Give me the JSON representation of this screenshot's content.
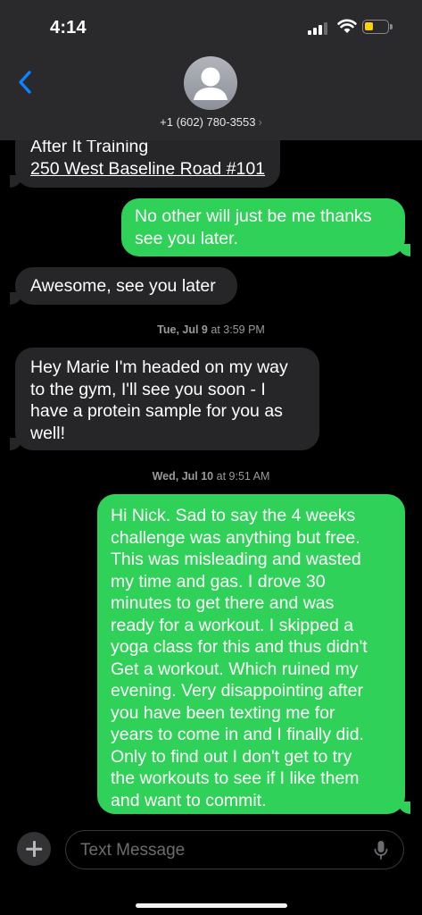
{
  "status_bar": {
    "time": "4:14"
  },
  "header": {
    "phone": "+1 (602) 780-3553",
    "chevron": "›"
  },
  "messages": [
    {
      "lines": [
        "After It Training",
        "250 West Baseline Road #101"
      ]
    },
    {
      "lines": [
        "No other will just be me thanks",
        "see you later."
      ]
    },
    {
      "lines": [
        "Awesome, see you later"
      ]
    },
    {
      "lines": [
        "Hey Marie I'm headed on my way",
        "to the gym, I'll see you soon - I",
        "have a protein sample for you as",
        "well!"
      ]
    },
    {
      "lines": [
        "Hi Nick. Sad to say the 4 weeks",
        "challenge was anything but free.",
        "This was misleading and wasted",
        "my time and gas. I drove 30",
        "minutes to get there and was",
        "ready for a workout. I skipped a",
        "yoga class for this and thus didn't",
        "Get a workout.  Which ruined my",
        "evening. Very disappointing after",
        "you have been texting me for",
        "years to come in and I finally did.",
        "Only to find out I don't get to try",
        "the workouts to see if I like them",
        "and want to commit."
      ]
    }
  ],
  "timestamps": [
    {
      "day": "Tue, Jul 9",
      "time": "at 3:59 PM"
    },
    {
      "day": "Wed, Jul 10",
      "time": "at 9:51 AM"
    }
  ],
  "composer": {
    "placeholder": "Text Message"
  },
  "icons": [
    "back-chevron-icon",
    "avatar-icon",
    "mic-icon",
    "plus-icon",
    "signal-icon",
    "wifi-icon",
    "battery-icon"
  ],
  "colors": {
    "sent_bubble": "#30d158",
    "received_bubble": "#262628",
    "link_blue": "#0a84ff",
    "battery": "#f8d211"
  }
}
